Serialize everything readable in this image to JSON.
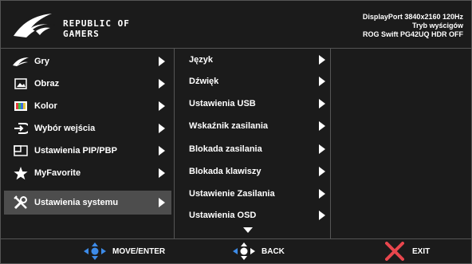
{
  "header": {
    "brand_line1": "REPUBLIC OF",
    "brand_line2": "GAMERS",
    "status_lines": [
      "DisplayPort 3840x2160 120Hz",
      "Tryb wyścigów",
      "ROG Swift PG42UQ HDR OFF"
    ]
  },
  "main_menu": {
    "items": [
      {
        "label": "Gry",
        "icon": "rog-eye-icon"
      },
      {
        "label": "Obraz",
        "icon": "image-icon"
      },
      {
        "label": "Kolor",
        "icon": "color-bars-icon"
      },
      {
        "label": "Wybór wejścia",
        "icon": "input-icon"
      },
      {
        "label": "Ustawienia PIP/PBP",
        "icon": "pip-icon"
      },
      {
        "label": "MyFavorite",
        "icon": "star-icon"
      },
      {
        "label": "Ustawienia systemu",
        "icon": "tools-icon",
        "selected": true
      }
    ]
  },
  "submenu": {
    "items": [
      {
        "label": "Język"
      },
      {
        "label": "Dźwięk"
      },
      {
        "label": "Ustawienia USB"
      },
      {
        "label": "Wskaźnik zasilania"
      },
      {
        "label": "Blokada zasilania"
      },
      {
        "label": "Blokada klawiszy"
      },
      {
        "label": "Ustawienie Zasilania"
      },
      {
        "label": "Ustawienia OSD"
      }
    ],
    "more_icon": "chevron-down-icon"
  },
  "footer": {
    "move_label": "MOVE/ENTER",
    "back_label": "BACK",
    "exit_label": "EXIT"
  },
  "colors": {
    "background": "#1b1b1b",
    "selected": "#4d4d4d",
    "nav_accent": "#3d8be8",
    "exit_accent": "#e8464d"
  }
}
